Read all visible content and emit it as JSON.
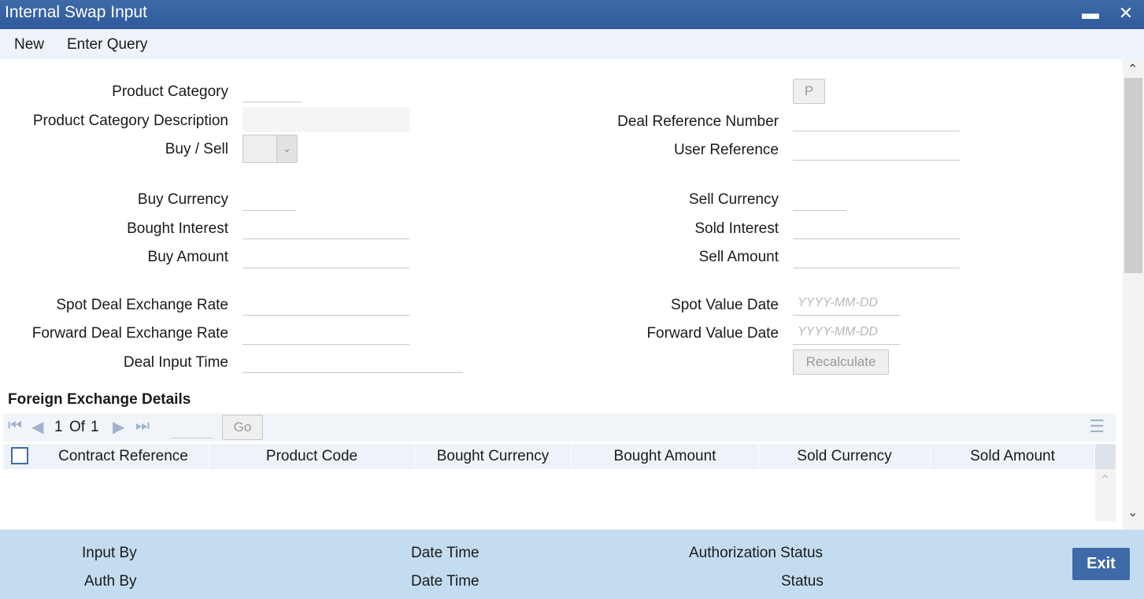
{
  "window": {
    "title": "Internal Swap Input",
    "minimize_label": "▬",
    "close_label": "✕"
  },
  "menu": {
    "new_label": "New",
    "enter_query_label": "Enter Query"
  },
  "form": {
    "product_category": {
      "label": "Product Category",
      "value": ""
    },
    "p_button_label": "P",
    "product_category_description": {
      "label": "Product Category Description",
      "value": ""
    },
    "deal_reference_number": {
      "label": "Deal Reference Number",
      "value": ""
    },
    "buy_sell": {
      "label": "Buy / Sell",
      "value": ""
    },
    "user_reference": {
      "label": "User Reference",
      "value": ""
    },
    "buy_currency": {
      "label": "Buy Currency",
      "value": ""
    },
    "sell_currency": {
      "label": "Sell Currency",
      "value": ""
    },
    "bought_interest": {
      "label": "Bought Interest",
      "value": ""
    },
    "sold_interest": {
      "label": "Sold Interest",
      "value": ""
    },
    "buy_amount": {
      "label": "Buy Amount",
      "value": ""
    },
    "sell_amount": {
      "label": "Sell Amount",
      "value": ""
    },
    "spot_deal_exchange_rate": {
      "label": "Spot Deal Exchange Rate",
      "value": ""
    },
    "spot_value_date": {
      "label": "Spot Value Date",
      "placeholder": "YYYY-MM-DD"
    },
    "forward_deal_exchange_rate": {
      "label": "Forward Deal Exchange Rate",
      "value": ""
    },
    "forward_value_date": {
      "label": "Forward Value Date",
      "placeholder": "YYYY-MM-DD"
    },
    "deal_input_time": {
      "label": "Deal Input Time",
      "value": ""
    },
    "recalculate_label": "Recalculate"
  },
  "fx_details": {
    "title": "Foreign Exchange Details",
    "pager": {
      "current": "1",
      "of_label": "Of",
      "total": "1",
      "go_label": "Go"
    },
    "columns": [
      "Contract Reference",
      "Product Code",
      "Bought Currency",
      "Bought Amount",
      "Sold Currency",
      "Sold Amount"
    ]
  },
  "footer": {
    "input_by_label": "Input By",
    "date_time_label_1": "Date Time",
    "authorization_status_label": "Authorization Status",
    "auth_by_label": "Auth By",
    "date_time_label_2": "Date Time",
    "status_label": "Status",
    "exit_label": "Exit"
  },
  "colors": {
    "titlebar": "#2f5a9a",
    "menubar": "#eef3f9",
    "footer": "#c3dcef",
    "exit_button": "#3f6aa8"
  }
}
